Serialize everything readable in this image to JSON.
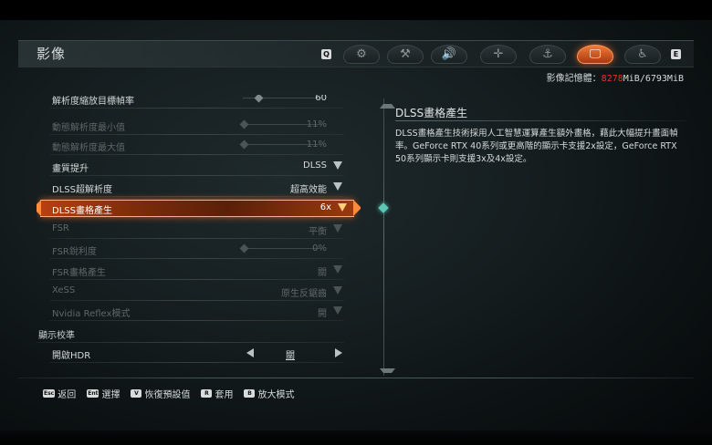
{
  "header": {
    "title": "影像",
    "key_left": "Q",
    "key_right": "E",
    "tabs": [
      {
        "name": "gear-icon",
        "glyph": "⚙"
      },
      {
        "name": "wrench-icon",
        "glyph": "⚒"
      },
      {
        "name": "speaker-icon",
        "glyph": "🔊"
      },
      {
        "name": "dpad-icon",
        "glyph": "✛"
      },
      {
        "name": "joystick-icon",
        "glyph": "⚓"
      },
      {
        "name": "monitor-icon",
        "glyph": "🖵"
      },
      {
        "name": "accessibility-icon",
        "glyph": "♿"
      }
    ]
  },
  "vram": {
    "label": "影像記憶體：",
    "used": "8278",
    "rest": "MiB/6793MiB"
  },
  "settings": [
    {
      "label": "解析度縮放目標幀率",
      "value": "60",
      "type": "slider",
      "knob": 0.2,
      "disabled": false
    },
    {
      "label": "動態解析度最小值",
      "value": "11%",
      "type": "slider",
      "knob": 0.0,
      "disabled": true
    },
    {
      "label": "動態解析度最大值",
      "value": "11%",
      "type": "slider",
      "knob": 0.0,
      "disabled": true
    },
    {
      "label": "畫質提升",
      "value": "DLSS",
      "type": "dropdown",
      "disabled": false
    },
    {
      "label": "DLSS超解析度",
      "value": "超高效能",
      "type": "dropdown",
      "disabled": false
    },
    {
      "label": "DLSS畫格產生",
      "value": "6x",
      "type": "dropdown",
      "disabled": false,
      "selected": true
    },
    {
      "label": "FSR",
      "value": "平衡",
      "type": "dropdown",
      "disabled": true
    },
    {
      "label": "FSR銳利度",
      "value": "0%",
      "type": "slider",
      "knob": 0.0,
      "disabled": true
    },
    {
      "label": "FSR畫格產生",
      "value": "關",
      "type": "dropdown",
      "disabled": true
    },
    {
      "label": "XeSS",
      "value": "原生反鋸齒",
      "type": "dropdown",
      "disabled": true
    },
    {
      "label": "Nvidia Reflex模式",
      "value": "開",
      "type": "dropdown",
      "disabled": true
    }
  ],
  "display_section": {
    "title": "顯示校準",
    "hdr_label": "開啟HDR",
    "hdr_value": "關"
  },
  "description": {
    "title": "DLSS畫格產生",
    "body": "DLSS畫格產生技術採用人工智慧運算產生額外畫格，藉此大幅提升畫面幀率。GeForce RTX 40系列或更高階的顯示卡支援2x設定，GeForce RTX 50系列顯示卡則支援3x及4x設定。"
  },
  "footer": [
    {
      "key": "Esc",
      "label": "返回"
    },
    {
      "key": "Ent",
      "label": "選擇"
    },
    {
      "key": "V",
      "label": "恢復預設值"
    },
    {
      "key": "R",
      "label": "套用"
    },
    {
      "key": "B",
      "label": "放大模式"
    }
  ]
}
